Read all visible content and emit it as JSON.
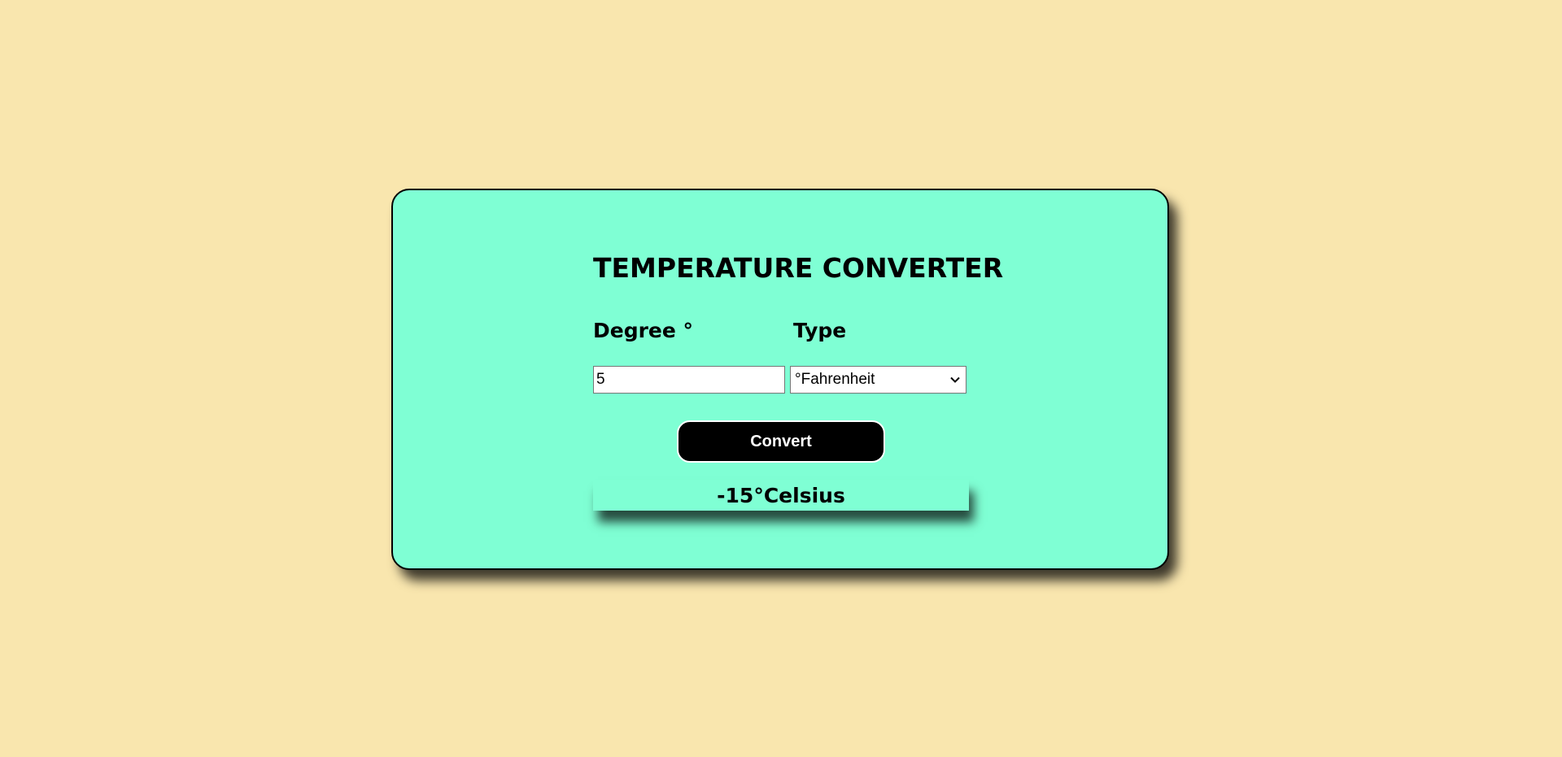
{
  "page": {
    "background_color": "#f9e6ae"
  },
  "card": {
    "background_color": "#7fffd4",
    "title": "TEMPERATURE CONVERTER",
    "degree_label": "Degree °",
    "type_label": "Type",
    "degree_input": {
      "value": "5"
    },
    "type_select": {
      "selected": "°Fahrenheit",
      "icon": "chevron-down-icon"
    },
    "convert_button": {
      "label": "Convert"
    },
    "result": {
      "text": "-15°Celsius"
    }
  }
}
